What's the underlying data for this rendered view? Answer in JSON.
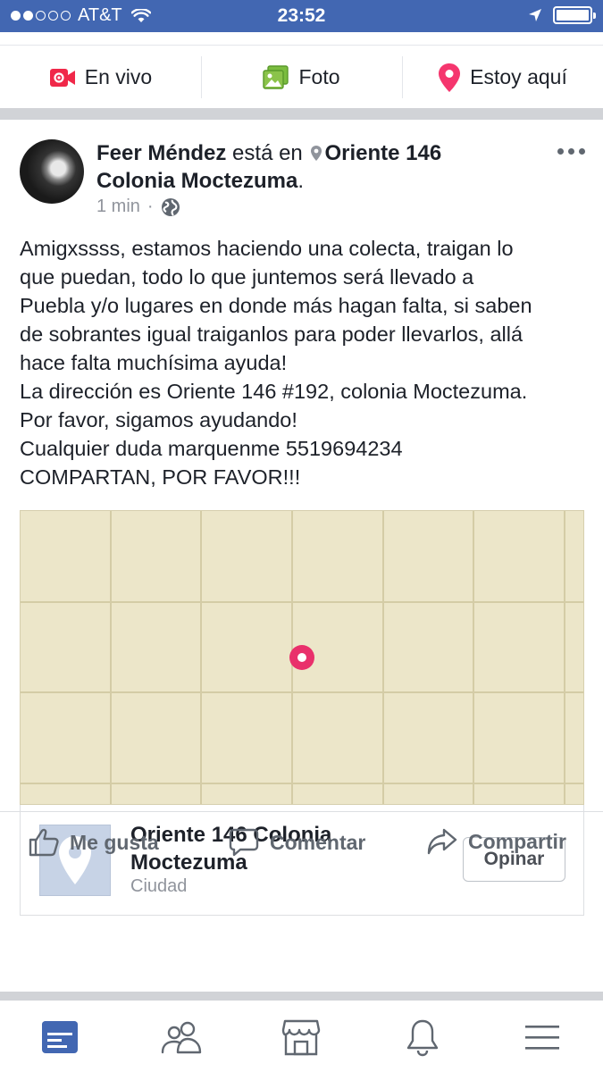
{
  "status_bar": {
    "carrier": "AT&T",
    "time": "23:52",
    "signal_bars": 2,
    "signal_total": 5
  },
  "composer": {
    "live_label": "En vivo",
    "photo_label": "Foto",
    "checkin_label": "Estoy aquí"
  },
  "post": {
    "author": "Feer Méndez",
    "connector": "está en",
    "location": "Oriente 146 Colonia Moctezuma",
    "time_ago": "1 min",
    "body_lines": [
      "Amigxssss, estamos haciendo una colecta, traigan lo",
      "que puedan, todo lo que juntemos será llevado a",
      "Puebla y/o lugares en donde más hagan falta, si saben",
      "de sobrantes igual traiganlos para poder llevarlos, allá",
      "hace falta muchísima ayuda!",
      "La dirección es Oriente 146 #192, colonia Moctezuma.",
      "Por favor, sigamos ayudando!",
      "Cualquier duda marquenme 5519694234",
      "COMPARTAN, POR FAVOR!!!"
    ]
  },
  "place_card": {
    "title": "Oriente 146 Colonia Moctezuma",
    "category": "Ciudad",
    "button_label": "Opinar"
  },
  "actions": {
    "like_label": "Me gusta",
    "comment_label": "Comentar",
    "share_label": "Compartir"
  },
  "tabs": [
    {
      "name": "news-feed",
      "active": true
    },
    {
      "name": "friends",
      "active": false
    },
    {
      "name": "marketplace",
      "active": false
    },
    {
      "name": "notifications",
      "active": false
    },
    {
      "name": "menu",
      "active": false
    }
  ],
  "colors": {
    "brand_blue": "#4267b2",
    "pin_pink": "#e9306b",
    "map_background": "#ece6c9",
    "text_gray": "#606770",
    "active_tab": "#4267b2"
  }
}
